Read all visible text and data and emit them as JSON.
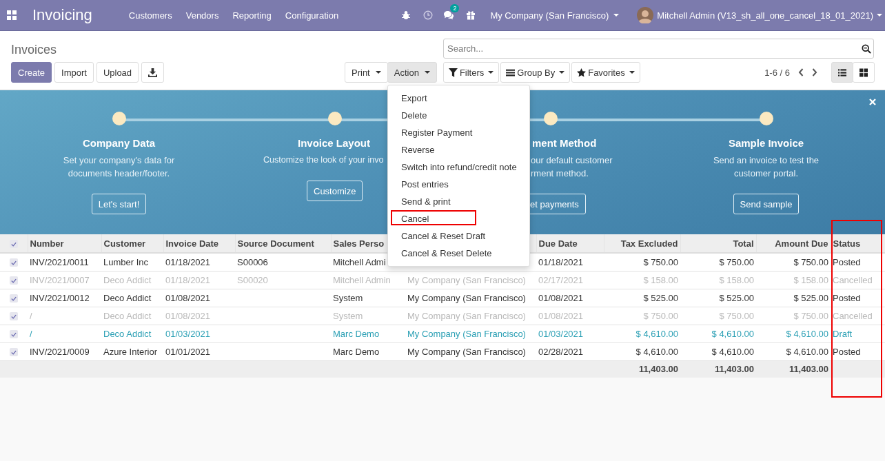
{
  "topbar": {
    "app_title": "Invoicing",
    "menu": [
      "Customers",
      "Vendors",
      "Reporting",
      "Configuration"
    ],
    "chat_count": "2",
    "company": "My Company (San Francisco)",
    "user": "Mitchell Admin (V13_sh_all_one_cancel_18_01_2021)"
  },
  "control_panel": {
    "title": "Invoices",
    "buttons": [
      {
        "label": "Create",
        "kind": "primary"
      },
      {
        "label": "Import",
        "kind": "secondary"
      },
      {
        "label": "Upload",
        "kind": "secondary"
      },
      {
        "kind": "download"
      }
    ],
    "actions": [
      {
        "label": "Print",
        "selected": false
      },
      {
        "label": "Action",
        "selected": true
      }
    ],
    "search": {
      "placeholder": "Search..."
    },
    "filters": [
      {
        "label": "Filters"
      },
      {
        "label": "Group By"
      },
      {
        "label": "Favorites"
      }
    ],
    "pager": "1-6 / 6",
    "views": [
      {
        "kind": "list",
        "selected": true
      },
      {
        "kind": "kanban",
        "selected": false
      }
    ]
  },
  "onboarding": {
    "steps": [
      {
        "title": "Company Data",
        "description": [
          "Set your company's data for",
          "documents header/footer."
        ],
        "button": "Let's start!",
        "partial": false
      },
      {
        "title": "Invoice Layout",
        "description": [
          "Customize the look of your invo"
        ],
        "button": "Customize",
        "partial": true
      },
      {
        "title": "ment Method",
        "description": [
          "our default customer",
          "rment method."
        ],
        "button": "et payments",
        "partial": true
      },
      {
        "title": "Sample Invoice",
        "description": [
          "Send an invoice to test the",
          "customer portal."
        ],
        "button": "Send sample",
        "partial": false
      }
    ]
  },
  "action_menu": {
    "items": [
      {
        "label": "Export",
        "highlighted": false
      },
      {
        "label": "Delete",
        "highlighted": false
      },
      {
        "label": "Register Payment",
        "highlighted": false
      },
      {
        "label": "Reverse",
        "highlighted": false
      },
      {
        "label": "Switch into refund/credit note",
        "highlighted": false
      },
      {
        "label": "Post entries",
        "highlighted": false
      },
      {
        "label": "Send & print",
        "highlighted": false
      },
      {
        "label": "Cancel",
        "highlighted": true
      },
      {
        "label": "Cancel & Reset Draft",
        "highlighted": false
      },
      {
        "label": "Cancel & Reset Delete",
        "highlighted": false
      }
    ]
  },
  "table": {
    "header_checked": true,
    "columns": [
      {
        "label": "Number",
        "kind": "text",
        "highlighted": false
      },
      {
        "label": "Customer",
        "kind": "text",
        "highlighted": false
      },
      {
        "label": "Invoice Date",
        "kind": "text",
        "highlighted": false
      },
      {
        "label": "Source Document",
        "kind": "text",
        "highlighted": false
      },
      {
        "label": "Sales Perso",
        "kind": "text",
        "highlighted": false
      },
      {
        "kind": "text",
        "highlighted": false
      },
      {
        "label": "Due Date",
        "kind": "text",
        "highlighted": false
      },
      {
        "label": "Tax Excluded",
        "kind": "money",
        "highlighted": false
      },
      {
        "label": "Total",
        "kind": "money",
        "highlighted": false
      },
      {
        "label": "Amount Due",
        "kind": "money",
        "highlighted": false
      },
      {
        "label": "Status",
        "kind": "text",
        "highlighted": true
      }
    ],
    "rows": [
      {
        "cancelled": false,
        "draft": false,
        "checked": true,
        "number": "INV/2021/0011",
        "customer": "Lumber Inc",
        "invoice_date": "01/18/2021",
        "source_document": "S00006",
        "sales_person": "Mitchell Admi",
        "due_date": "01/18/2021",
        "tax_excluded": "$ 750.00",
        "total": "$ 750.00",
        "amount_due": "$ 750.00",
        "status": "Posted"
      },
      {
        "cancelled": true,
        "draft": false,
        "checked": true,
        "number": "INV/2021/0007",
        "customer": "Deco Addict",
        "invoice_date": "01/18/2021",
        "source_document": "S00020",
        "sales_person": "Mitchell Admin",
        "company": "My Company (San Francisco)",
        "due_date": "02/17/2021",
        "tax_excluded": "$ 158.00",
        "total": "$ 158.00",
        "amount_due": "$ 158.00",
        "status": "Cancelled"
      },
      {
        "cancelled": false,
        "draft": false,
        "checked": true,
        "number": "INV/2021/0012",
        "customer": "Deco Addict",
        "invoice_date": "01/08/2021",
        "sales_person": "System",
        "company": "My Company (San Francisco)",
        "due_date": "01/08/2021",
        "tax_excluded": "$ 525.00",
        "total": "$ 525.00",
        "amount_due": "$ 525.00",
        "status": "Posted"
      },
      {
        "cancelled": true,
        "draft": false,
        "checked": true,
        "number": "/",
        "customer": "Deco Addict",
        "invoice_date": "01/08/2021",
        "sales_person": "System",
        "company": "My Company (San Francisco)",
        "due_date": "01/08/2021",
        "tax_excluded": "$ 750.00",
        "total": "$ 750.00",
        "amount_due": "$ 750.00",
        "status": "Cancelled"
      },
      {
        "cancelled": false,
        "draft": true,
        "checked": true,
        "number": "/",
        "customer": "Deco Addict",
        "invoice_date": "01/03/2021",
        "sales_person": "Marc Demo",
        "company": "My Company (San Francisco)",
        "due_date": "01/03/2021",
        "tax_excluded": "$ 4,610.00",
        "total": "$ 4,610.00",
        "amount_due": "$ 4,610.00",
        "status": "Draft"
      },
      {
        "cancelled": false,
        "draft": false,
        "checked": true,
        "number": "INV/2021/0009",
        "customer": "Azure Interior",
        "invoice_date": "01/01/2021",
        "sales_person": "Marc Demo",
        "company": "My Company (San Francisco)",
        "due_date": "02/28/2021",
        "tax_excluded": "$ 4,610.00",
        "total": "$ 4,610.00",
        "amount_due": "$ 4,610.00",
        "status": "Posted"
      }
    ],
    "totals": {
      "tax_excluded": "11,403.00",
      "total": "11,403.00",
      "amount_due": "11,403.00"
    }
  }
}
